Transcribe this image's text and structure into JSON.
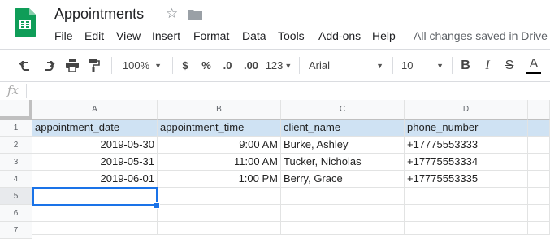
{
  "doc": {
    "title": "Appointments",
    "save_status": "All changes saved in Drive"
  },
  "menu": [
    "File",
    "Edit",
    "View",
    "Insert",
    "Format",
    "Data",
    "Tools",
    "Add-ons",
    "Help"
  ],
  "toolbar": {
    "zoom": "100%",
    "currency": "$",
    "percent": "%",
    "decrease_decimals": ".0",
    "increase_decimals": ".00",
    "more_formats": "123",
    "font": "Arial",
    "font_size": "10",
    "bold": "B",
    "italic": "I",
    "strike": "S",
    "text_color": "A"
  },
  "formula": {
    "fx": "fx",
    "value": ""
  },
  "columns": [
    "A",
    "B",
    "C",
    "D"
  ],
  "rows": [
    "1",
    "2",
    "3",
    "4",
    "5",
    "6",
    "7"
  ],
  "cells": {
    "r1": [
      "appointment_date",
      "appointment_time",
      "client_name",
      "phone_number"
    ],
    "r2": [
      "2019-05-30",
      "9:00 AM",
      "Burke, Ashley",
      "+17775553333"
    ],
    "r3": [
      "2019-05-31",
      "11:00 AM",
      "Tucker, Nicholas",
      "+17775553334"
    ],
    "r4": [
      "2019-06-01",
      "1:00 PM",
      "Berry, Grace",
      "+17775553335"
    ]
  },
  "selected_cell": "A5",
  "colors": {
    "header_highlight": "#cfe2f3",
    "selection": "#1a73e8",
    "logo": "#0f9d58"
  }
}
